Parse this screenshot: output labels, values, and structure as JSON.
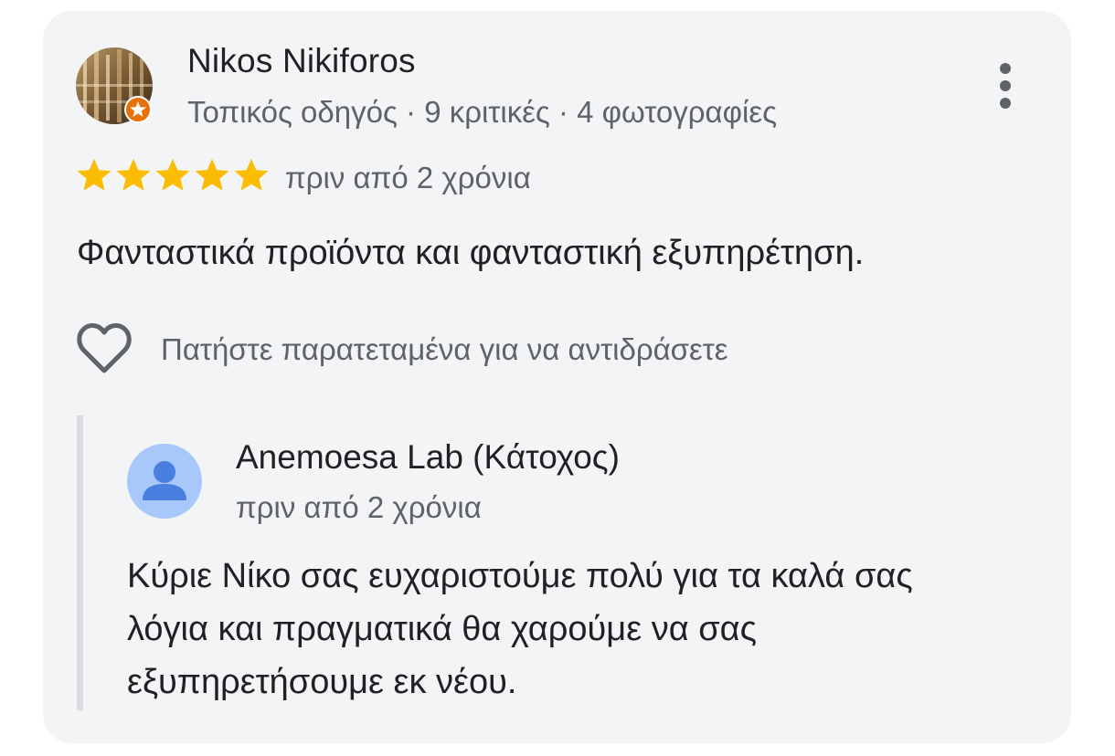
{
  "review": {
    "reviewer_name": "Nikos Nikiforos",
    "reviewer_meta": "Τοπικός οδηγός · 9 κριτικές · 4 φωτογραφίες",
    "rating": 5,
    "rating_max": 5,
    "time": "πριν από 2 χρόνια",
    "text": "Φανταστικά προϊόντα και φανταστική εξυπηρέτηση.",
    "react_hint": "Πατήστε παρατεταμένα για να αντιδράσετε"
  },
  "owner_reply": {
    "name": "Anemoesa Lab (Κάτοχος)",
    "time": "πριν από 2 χρόνια",
    "text_lines": [
      "Κύριε Νίκο σας ευχαριστούμε πολύ για τα καλά σας",
      "λόγια και πραγματικά θα χαρούμε να σας",
      "εξυπηρετήσουμε εκ νέου."
    ]
  },
  "icons": {
    "more": "more-vert-icon",
    "star": "star-icon",
    "heart": "heart-outline-icon",
    "avatar_placeholder": "person-icon",
    "local_guide_badge": "local-guide-badge-icon"
  },
  "colors": {
    "card_background": "#f3f4f6",
    "star": "#fbbc04",
    "local_guide_badge": "#e8710a",
    "owner_avatar_background": "#a8c7fa",
    "owner_avatar_icon": "#4a7fe0",
    "reply_bar": "#dadce0"
  }
}
